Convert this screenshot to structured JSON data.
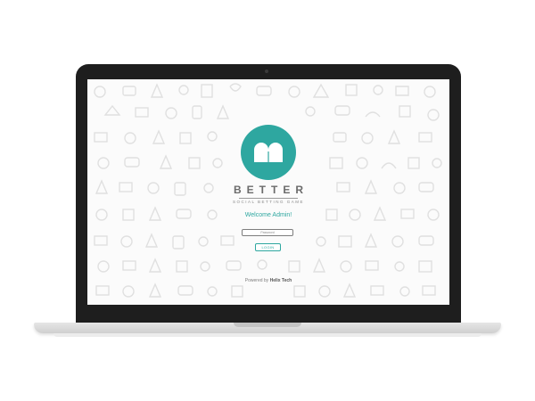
{
  "app": {
    "brand": "BETTER",
    "tagline": "SOCIAL BETTING GAME",
    "logo_icon": "b-logo-icon"
  },
  "login": {
    "welcome": "Welcome Admin!",
    "password_placeholder": "Password",
    "login_label": "LOGIN"
  },
  "footer": {
    "powered_prefix": "Powered by",
    "company": "Helix Tech"
  },
  "colors": {
    "accent": "#2ea7a0",
    "bezel": "#1e1e1e",
    "screen_bg": "#fbfbfb",
    "pattern": "#e2e2e2"
  }
}
